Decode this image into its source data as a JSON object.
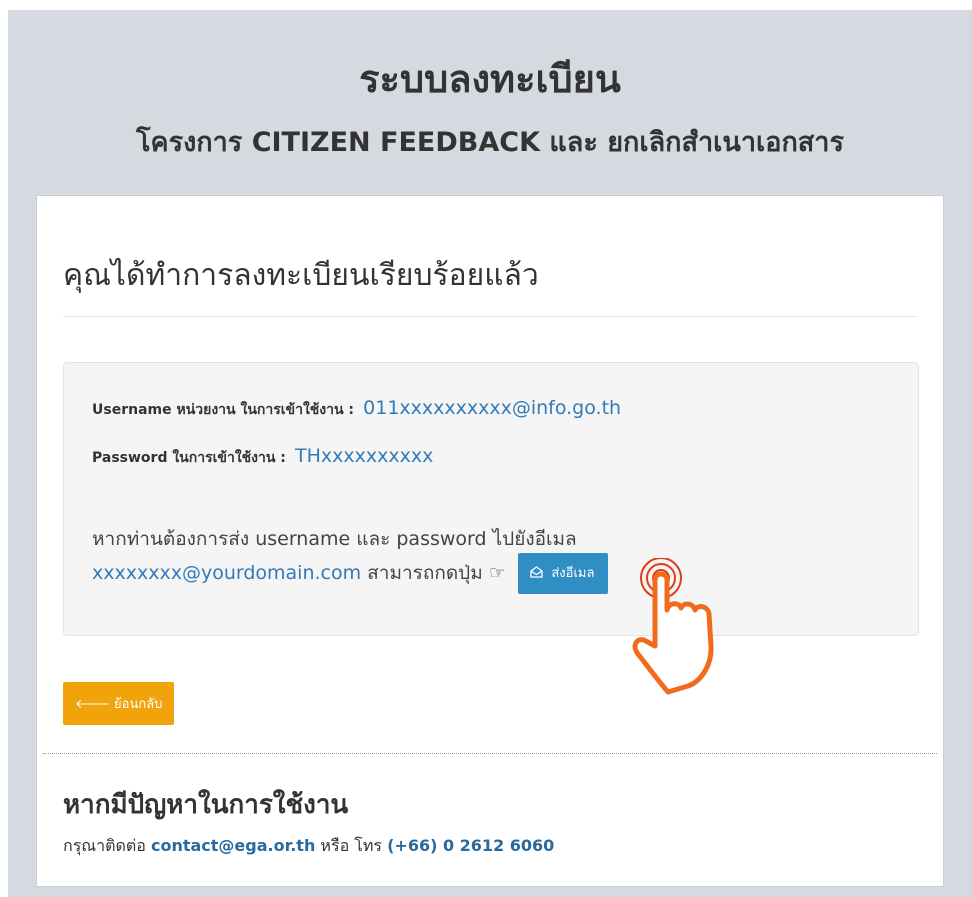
{
  "header": {
    "title": "ระบบลงทะเบียน",
    "subtitle": "โครงการ CITIZEN FEEDBACK และ ยกเลิกสำเนาเอกสาร"
  },
  "card": {
    "heading": "คุณได้ทำการลงทะเบียนเรียบร้อยแล้ว",
    "credentials": {
      "username_label": "Username หน่วยงาน ในการเข้าใช้งาน :",
      "username_value": "011xxxxxxxxxx@info.go.th",
      "password_label": "Password ในการเข้าใช้งาน :",
      "password_value": "THxxxxxxxxxx"
    },
    "note": {
      "line1": "หากท่านต้องการส่ง username และ password ไปยังอีเมล",
      "email": "xxxxxxxx@yourdomain.com",
      "press_text": "สามารถกดปุ่ม",
      "pointer_glyph": "☞",
      "send_button_label": "ส่งอีเมล",
      "send_button_icon": "envelope-open-icon"
    },
    "back_button_label": "ย้อนกลับ",
    "back_button_icon": "arrow-left-icon",
    "help": {
      "heading": "หากมีปัญหาในการใช้งาน",
      "contact_prefix": "กรุณาติดต่อ",
      "contact_email": "contact@ega.or.th",
      "contact_or": "หรือ โทร",
      "contact_phone": "(+66) 0 2612 6060"
    }
  },
  "colors": {
    "background": "#d5d9e0",
    "link": "#337ab7",
    "send_button": "#2f8fc4",
    "back_button": "#f0a30a",
    "cursor_annotation": "#f26b1d"
  }
}
